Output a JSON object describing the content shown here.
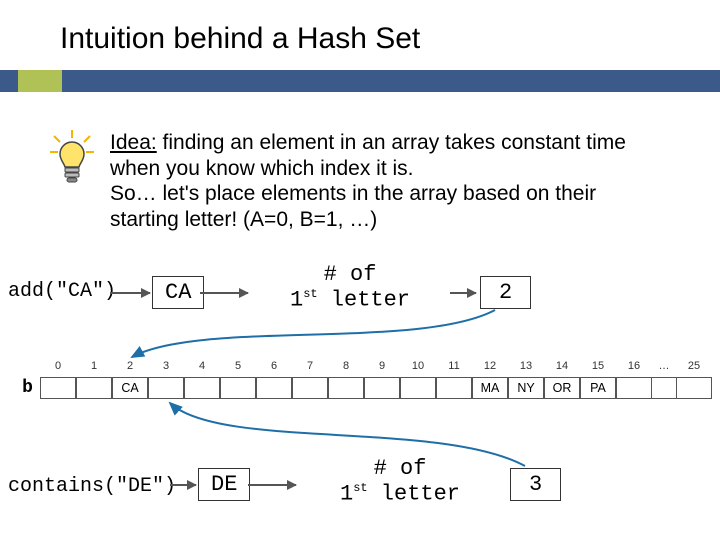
{
  "title": "Intuition behind a Hash Set",
  "idea": {
    "lead": "Idea:",
    "body1": " finding an element in an array takes constant time when you know which index it is.",
    "body2": "So… let's place elements in the array based on their starting letter! (A=0, B=1, …)"
  },
  "add": {
    "call": "add(\"CA\")",
    "box": "CA",
    "hash_line1": "# of",
    "hash_line2_pre": "1",
    "hash_line2_sup": "st",
    "hash_line2_post": " letter",
    "result": "2"
  },
  "array": {
    "row_label": "b",
    "indices": [
      "0",
      "1",
      "2",
      "3",
      "4",
      "5",
      "6",
      "7",
      "8",
      "9",
      "10",
      "11",
      "12",
      "13",
      "14",
      "15",
      "16",
      "…",
      "25"
    ],
    "cells": [
      "",
      "",
      "CA",
      "",
      "",
      "",
      "",
      "",
      "",
      "",
      "",
      "",
      "MA",
      "NY",
      "OR",
      "PA",
      "",
      "",
      "",
      ""
    ]
  },
  "contains": {
    "call": "contains(\"DE\")",
    "box": "DE",
    "hash_line1": "# of",
    "hash_line2_pre": "1",
    "hash_line2_sup": "st",
    "hash_line2_post": " letter",
    "result": "3"
  }
}
